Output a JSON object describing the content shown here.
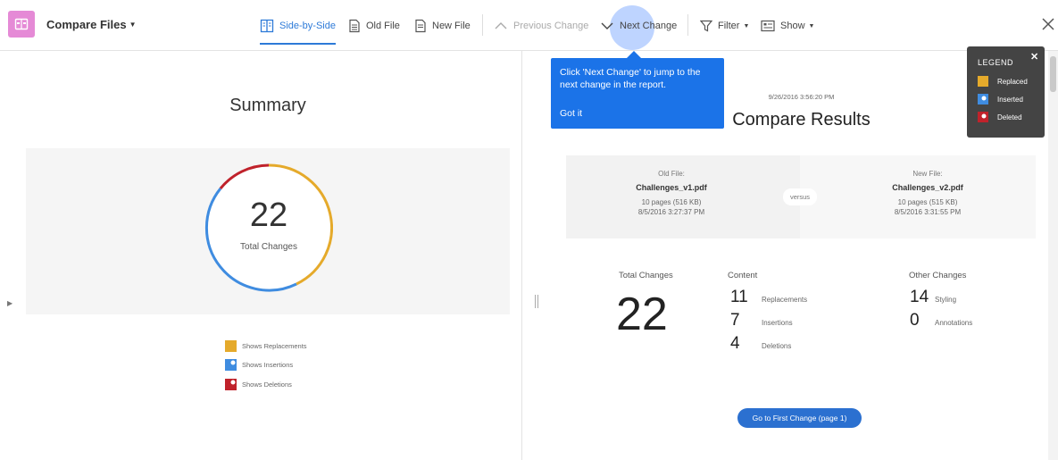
{
  "toolbar": {
    "app_title": "Compare Files",
    "side_by_side": "Side-by-Side",
    "old_file": "Old File",
    "new_file": "New File",
    "previous_change": "Previous Change",
    "next_change": "Next Change",
    "filter": "Filter",
    "show": "Show"
  },
  "summary": {
    "title": "Summary",
    "total": "22",
    "total_label": "Total Changes",
    "keys": [
      "Shows Replacements",
      "Shows Insertions",
      "Shows Deletions"
    ]
  },
  "tooltip": {
    "text": "Click 'Next Change' to jump to the next change in the report.",
    "got_it": "Got it"
  },
  "report": {
    "date": "9/26/2016 3:56:20 PM",
    "title": "Compare Results",
    "old_file": {
      "header": "Old File:",
      "name": "Challenges_v1.pdf",
      "pages": "10 pages (516 KB)",
      "date": "8/5/2016 3:27:37 PM"
    },
    "versus": "versus",
    "new_file": {
      "header": "New File:",
      "name": "Challenges_v2.pdf",
      "pages": "10 pages (515 KB)",
      "date": "8/5/2016 3:31:55 PM"
    },
    "total_changes_label": "Total Changes",
    "total_changes": "22",
    "content_label": "Content",
    "content": [
      {
        "n": "11",
        "label": "Replacements"
      },
      {
        "n": "7",
        "label": "Insertions"
      },
      {
        "n": "4",
        "label": "Deletions"
      }
    ],
    "other_label": "Other Changes",
    "other": [
      {
        "n": "14",
        "label": "Styling"
      },
      {
        "n": "0",
        "label": "Annotations"
      }
    ],
    "goto_button": "Go to First Change (page 1)"
  },
  "legend": {
    "title": "LEGEND",
    "items": [
      "Replaced",
      "Inserted",
      "Deleted"
    ]
  },
  "colors": {
    "replaced": "#e5aa2b",
    "inserted": "#3f8ce0",
    "deleted": "#c0222b",
    "accent": "#2d7ad8"
  }
}
